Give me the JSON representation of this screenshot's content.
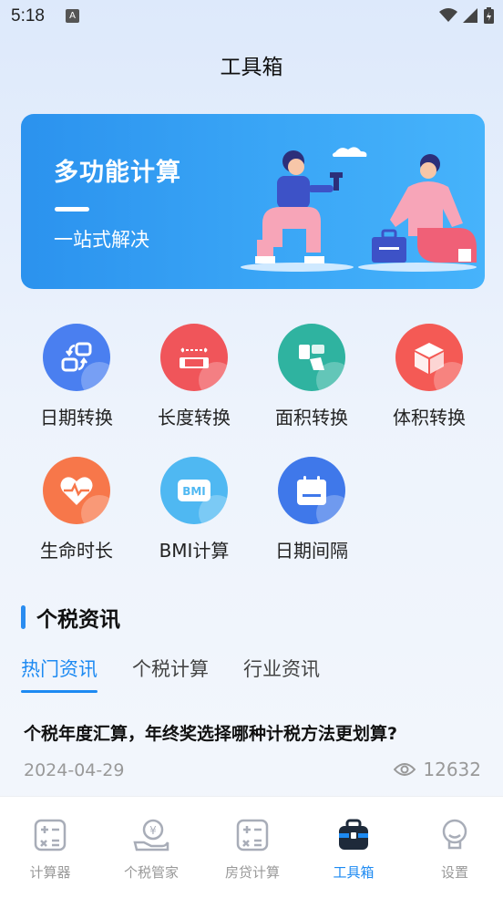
{
  "status": {
    "time": "5:18",
    "notify_letter": "A"
  },
  "header": {
    "title": "工具箱"
  },
  "banner": {
    "title": "多功能计算",
    "subtitle": "一站式解决"
  },
  "tools": [
    {
      "label": "日期转换",
      "icon": "date-convert-icon",
      "color": "#4a7ff0"
    },
    {
      "label": "长度转换",
      "icon": "ruler-icon",
      "color": "#f0555a"
    },
    {
      "label": "面积转换",
      "icon": "area-icon",
      "color": "#2fb3a0"
    },
    {
      "label": "体积转换",
      "icon": "cube-icon",
      "color": "#f45a55"
    },
    {
      "label": "生命时长",
      "icon": "heart-pulse-icon",
      "color": "#f7774a"
    },
    {
      "label": "BMI计算",
      "icon": "bmi-icon",
      "color": "#4fb8f2",
      "icon_text": "BMI"
    },
    {
      "label": "日期间隔",
      "icon": "calendar-icon",
      "color": "#3f78ea"
    }
  ],
  "news": {
    "section_title": "个税资讯",
    "tabs": [
      "热门资讯",
      "个税计算",
      "行业资讯"
    ],
    "active_tab": 0,
    "article": {
      "title": "个税年度汇算，年终奖选择哪种计税方法更划算?",
      "date": "2024-04-29",
      "views": "12632"
    }
  },
  "bottom_nav": [
    {
      "label": "计算器",
      "icon": "calculator-icon"
    },
    {
      "label": "个税管家",
      "icon": "tax-hand-icon"
    },
    {
      "label": "房贷计算",
      "icon": "mortgage-calculator-icon"
    },
    {
      "label": "工具箱",
      "icon": "toolbox-icon",
      "active": true
    },
    {
      "label": "设置",
      "icon": "settings-icon"
    }
  ],
  "colors": {
    "accent": "#1d8af2",
    "banner": "#3aa6f6"
  }
}
